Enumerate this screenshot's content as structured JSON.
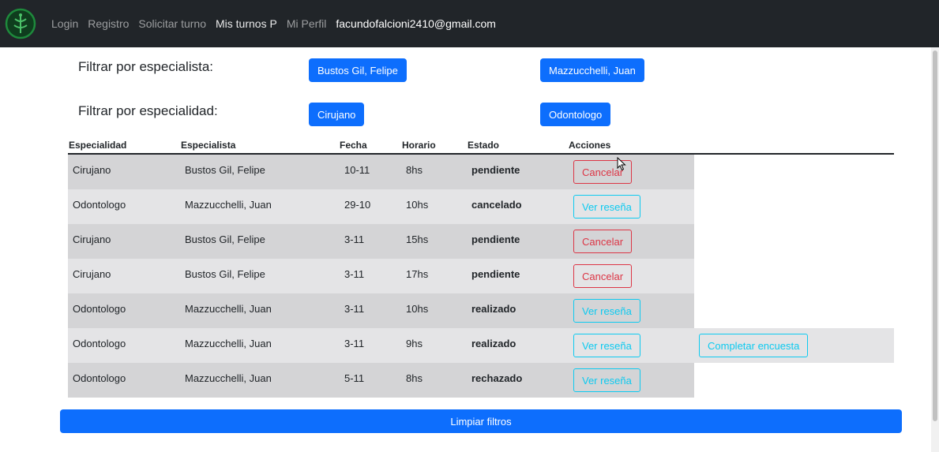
{
  "nav": {
    "links": [
      "Login",
      "Registro",
      "Solicitar turno",
      "Mis turnos P",
      "Mi Perfil"
    ],
    "email": "facundofalcioni2410@gmail.com"
  },
  "filters": {
    "especialista_label": "Filtrar por especialista:",
    "especialistas": [
      "Bustos Gil, Felipe",
      "Mazzucchelli, Juan"
    ],
    "especialidad_label": "Filtrar por especialidad:",
    "especialidades": [
      "Cirujano",
      "Odontologo"
    ]
  },
  "table": {
    "headers": [
      "Especialidad",
      "Especialista",
      "Fecha",
      "Horario",
      "Estado",
      "Acciones"
    ],
    "rows": [
      {
        "especialidad": "Cirujano",
        "especialista": "Bustos Gil, Felipe",
        "fecha": "10-11",
        "horario": "8hs",
        "estado": "pendiente",
        "accion": "Cancelar",
        "extra": ""
      },
      {
        "especialidad": "Odontologo",
        "especialista": "Mazzucchelli, Juan",
        "fecha": "29-10",
        "horario": "10hs",
        "estado": "cancelado",
        "accion": "Ver reseña",
        "extra": ""
      },
      {
        "especialidad": "Cirujano",
        "especialista": "Bustos Gil, Felipe",
        "fecha": "3-11",
        "horario": "15hs",
        "estado": "pendiente",
        "accion": "Cancelar",
        "extra": ""
      },
      {
        "especialidad": "Cirujano",
        "especialista": "Bustos Gil, Felipe",
        "fecha": "3-11",
        "horario": "17hs",
        "estado": "pendiente",
        "accion": "Cancelar",
        "extra": ""
      },
      {
        "especialidad": "Odontologo",
        "especialista": "Mazzucchelli, Juan",
        "fecha": "3-11",
        "horario": "10hs",
        "estado": "realizado",
        "accion": "Ver reseña",
        "extra": ""
      },
      {
        "especialidad": "Odontologo",
        "especialista": "Mazzucchelli, Juan",
        "fecha": "3-11",
        "horario": "9hs",
        "estado": "realizado",
        "accion": "Ver reseña",
        "extra": "Completar encuesta"
      },
      {
        "especialidad": "Odontologo",
        "especialista": "Mazzucchelli, Juan",
        "fecha": "5-11",
        "horario": "8hs",
        "estado": "rechazado",
        "accion": "Ver reseña",
        "extra": ""
      }
    ]
  },
  "clear_filters_label": "Limpiar filtros",
  "colors": {
    "navbar": "#212529",
    "primary": "#0d6efd",
    "danger": "#dc3545",
    "info": "#0dcaf0",
    "logo": "#1e8a3c"
  }
}
